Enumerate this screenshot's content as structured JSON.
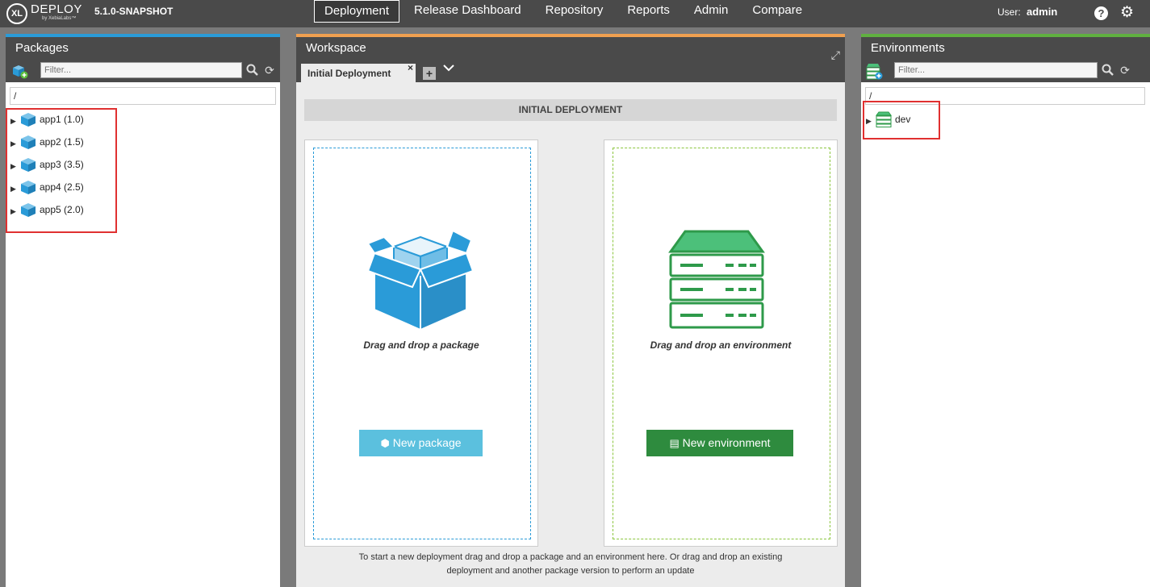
{
  "topbar": {
    "logo": "XL",
    "brand": "DEPLOY",
    "brand_sub": "by XebiaLabs™",
    "version": "5.1.0-SNAPSHOT",
    "nav": [
      "Deployment",
      "Release Dashboard",
      "Repository",
      "Reports",
      "Admin",
      "Compare"
    ],
    "active_nav": "Deployment",
    "user_label": "User:",
    "user_name": "admin",
    "help_glyph": "?",
    "icons": [
      "help-icon",
      "gear-icon"
    ]
  },
  "packages": {
    "title": "Packages",
    "accent_color": "#2a9bd8",
    "filter_placeholder": "Filter...",
    "root": "/",
    "items": [
      {
        "label": "app1 (1.0)"
      },
      {
        "label": "app2 (1.5)"
      },
      {
        "label": "app3 (3.5)"
      },
      {
        "label": "app4 (2.5)"
      },
      {
        "label": "app5 (2.0)"
      }
    ]
  },
  "workspace": {
    "title": "Workspace",
    "accent_color": "#f0a050",
    "tab_label": "Initial Deployment",
    "tab_close": "×",
    "tab_add": "+",
    "heading": "INITIAL DEPLOYMENT",
    "package_drop_text": "Drag and drop a package",
    "environment_drop_text": "Drag and drop an environment",
    "new_package_label": "New package",
    "new_environment_label": "New environment",
    "footer_line1": "To start a new deployment drag and drop a package and an environment here. Or drag and drop an existing",
    "footer_line2": "deployment and another package version to perform an update",
    "package_color": "#2a9bd8",
    "environment_color": "#2e9a4a"
  },
  "environments": {
    "title": "Environments",
    "accent_color": "#60b040",
    "filter_placeholder": "Filter...",
    "root": "/",
    "items": [
      {
        "label": "dev"
      }
    ]
  }
}
